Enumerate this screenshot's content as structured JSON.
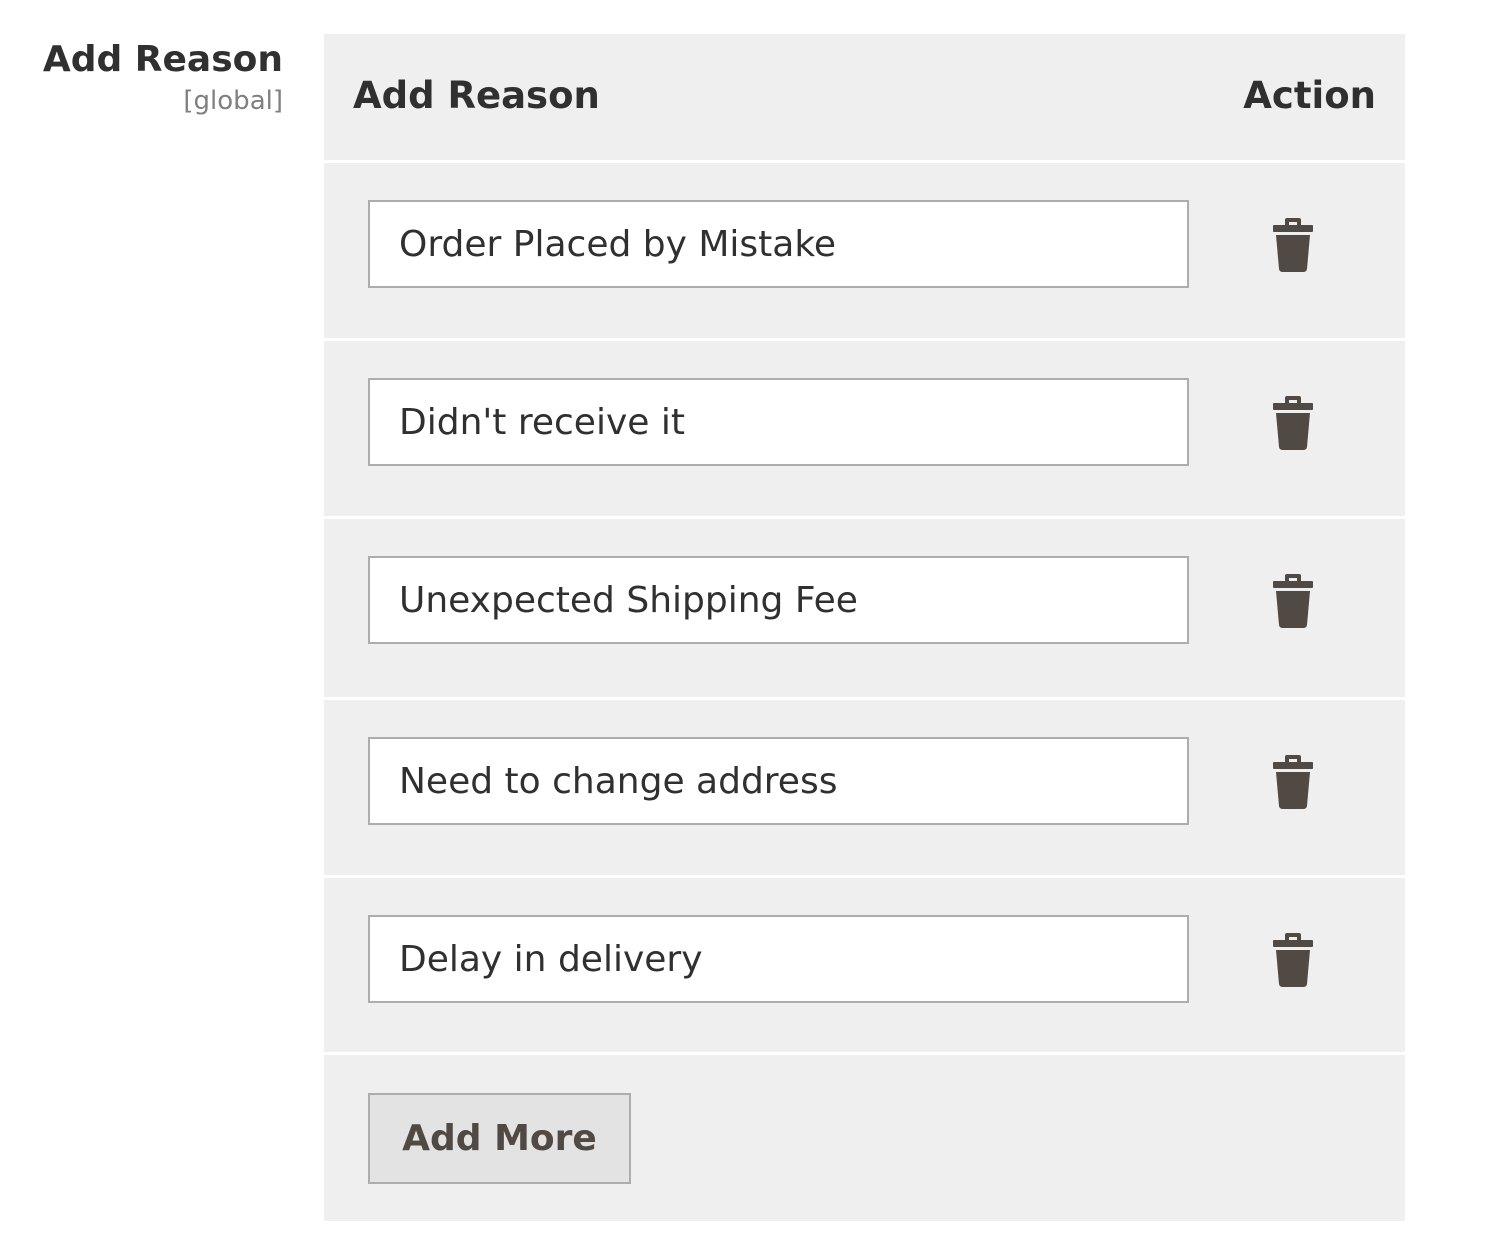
{
  "field": {
    "label": "Add Reason",
    "scope": "[global]"
  },
  "grid": {
    "columns": {
      "reason": "Add Reason",
      "action": "Action"
    },
    "rows": [
      {
        "value": "Order Placed by Mistake",
        "action_icon": "trash-icon"
      },
      {
        "value": "Didn't receive it",
        "action_icon": "trash-icon"
      },
      {
        "value": "Unexpected Shipping Fee",
        "action_icon": "trash-icon"
      },
      {
        "value": "Need to change address",
        "action_icon": "trash-icon"
      },
      {
        "value": "Delay in delivery",
        "action_icon": "trash-icon"
      }
    ],
    "add_button_label": "Add More"
  },
  "colors": {
    "panel_bg": "#efefef",
    "icon": "#514943",
    "label_text": "#303030",
    "scope_text": "#808080"
  }
}
